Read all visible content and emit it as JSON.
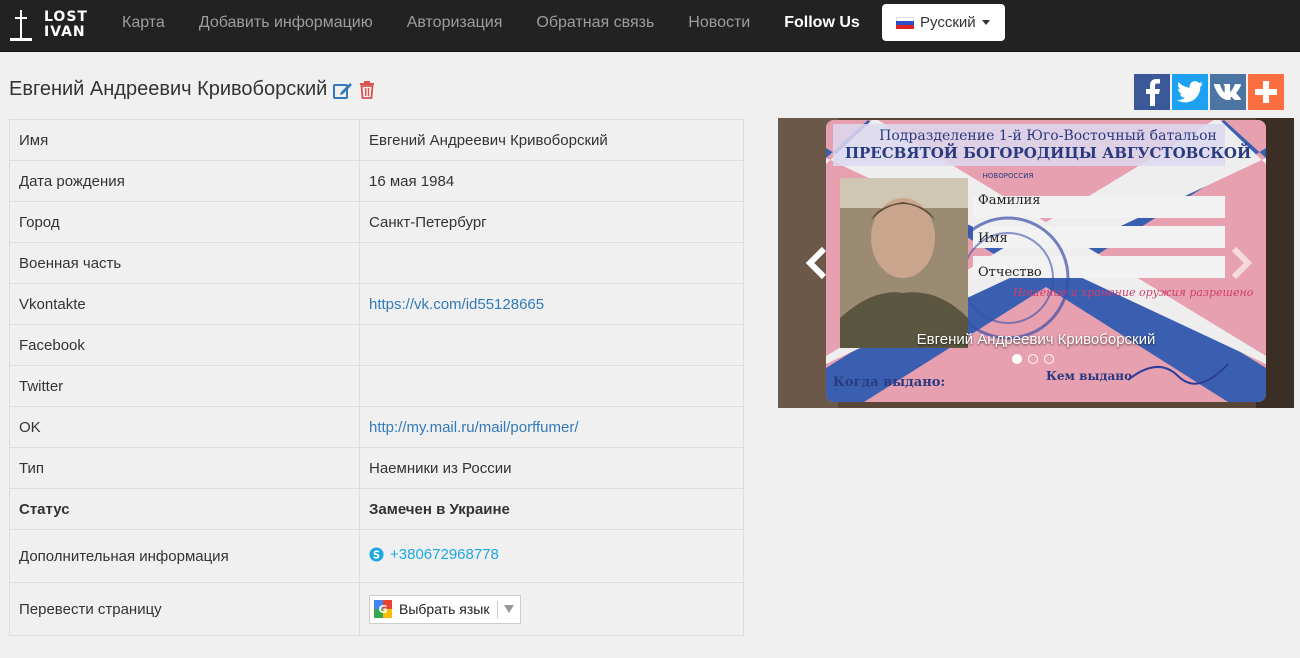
{
  "brand": {
    "line1": "LOST",
    "line2": "IVAN"
  },
  "nav": {
    "items": [
      "Карта",
      "Добавить информацию",
      "Авторизация",
      "Обратная связь",
      "Новости"
    ],
    "follow": "Follow Us",
    "language": "Русский"
  },
  "page": {
    "title": "Евгений Андреевич Кривоборский"
  },
  "social": [
    "facebook-icon",
    "twitter-icon",
    "vk-icon",
    "share-plus-icon"
  ],
  "info": {
    "rows": [
      {
        "key": "Имя",
        "value": "Евгений Андреевич Кривоборский"
      },
      {
        "key": "Дата рождения",
        "value": "16 мая 1984"
      },
      {
        "key": "Город",
        "value": "Санкт-Петербург"
      },
      {
        "key": "Военная часть",
        "value": ""
      },
      {
        "key": "Vkontakte",
        "value": "https://vk.com/id55128665"
      },
      {
        "key": "Facebook",
        "value": ""
      },
      {
        "key": "Twitter",
        "value": ""
      },
      {
        "key": "OK",
        "value": "http://my.mail.ru/mail/porffumer/"
      },
      {
        "key": "Тип",
        "value": "Наемники из России"
      },
      {
        "key": "Статус",
        "value": "Замечен в Украине"
      },
      {
        "key": "Дополнительная информация",
        "value": "+380672968778"
      },
      {
        "key": "Перевести страницу",
        "value": "Выбрать язык"
      }
    ]
  },
  "carousel": {
    "caption": "Евгений Андреевич Кривоборский",
    "dots": 3,
    "active_dot": 0,
    "card": {
      "line1": "Подразделение 1-й Юго-Восточный батальон",
      "line2": "ПРЕСВЯТОЙ БОГОРОДИЦЫ АВГУСТОВСКОЙ",
      "brand": "НОВОРОССИЯ",
      "f1": "Фамилия",
      "f2": "Имя",
      "f3": "Отчество",
      "stamp": "Ношение и хранение оружия разрешено",
      "issued": "Когда выдано:",
      "issuer": "Кем выдано"
    }
  },
  "colors": {
    "accent": "#337ab7",
    "danger": "#d9534f",
    "navbar": "#222222",
    "skype": "#1ea7e1"
  }
}
